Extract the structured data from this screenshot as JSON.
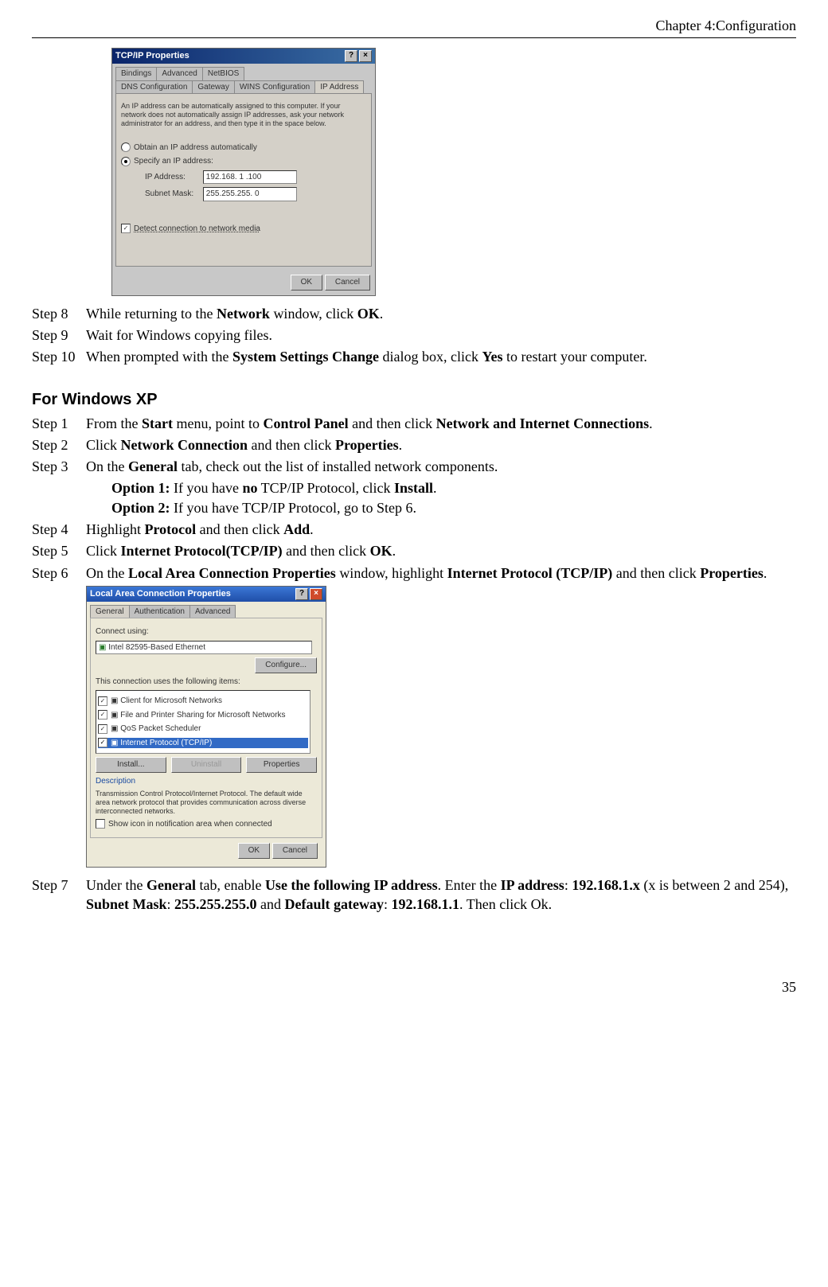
{
  "header": {
    "chapter": "Chapter 4:Configuration"
  },
  "footer": {
    "page": "35"
  },
  "dlg1": {
    "title": "TCP/IP Properties",
    "tabs_row1": [
      "Bindings",
      "Advanced",
      "NetBIOS"
    ],
    "tabs_row2": [
      "DNS Configuration",
      "Gateway",
      "WINS Configuration",
      "IP Address"
    ],
    "desc": "An IP address can be automatically assigned to this computer. If your network does not automatically assign IP addresses, ask your network administrator for an address, and then type it in the space below.",
    "opt_auto": "Obtain an IP address automatically",
    "opt_spec": "Specify an IP address:",
    "lbl_ip": "IP Address:",
    "val_ip": "192.168. 1 .100",
    "lbl_mask": "Subnet Mask:",
    "val_mask": "255.255.255. 0",
    "detect": "Detect connection to network media",
    "ok": "OK",
    "cancel": "Cancel"
  },
  "steps_a": {
    "s8_lbl": "Step 8",
    "s8_a": "While returning to the ",
    "s8_b": "Network",
    "s8_c": " window, click ",
    "s8_d": "OK",
    "s8_e": ".",
    "s9_lbl": "Step 9",
    "s9": "Wait for Windows copying files.",
    "s10_lbl": "Step 10",
    "s10_a": "When prompted with the ",
    "s10_b": "System Settings Change",
    "s10_c": " dialog box, click ",
    "s10_d": "Yes",
    "s10_e": " to restart your computer."
  },
  "section_xp": "For Windows XP",
  "xp": {
    "s1_lbl": "Step 1",
    "s1_a": "From the ",
    "s1_b": "Start",
    "s1_c": " menu, point to ",
    "s1_d": "Control Panel",
    "s1_e": " and then click ",
    "s1_f": "Network and Internet    Connections",
    "s1_g": ".",
    "s2_lbl": "Step 2",
    "s2_a": "Click ",
    "s2_b": "Network Connection",
    "s2_c": " and then click ",
    "s2_d": "Properties",
    "s2_e": ".",
    "s3_lbl": "Step 3",
    "s3_a": "On the ",
    "s3_b": "General",
    "s3_c": " tab, check out the list of installed network components.",
    "s3_o1_a": "Option 1:",
    "s3_o1_b": " If you have ",
    "s3_o1_c": "no",
    "s3_o1_d": " TCP/IP Protocol, click ",
    "s3_o1_e": "Install",
    "s3_o1_f": ".",
    "s3_o2_a": "Option 2:",
    "s3_o2_b": " If you have TCP/IP Protocol, go to Step 6.",
    "s4_lbl": "Step 4",
    "s4_a": "Highlight ",
    "s4_b": "Protocol",
    "s4_c": " and then click ",
    "s4_d": "Add",
    "s4_e": ".",
    "s5_lbl": "Step 5",
    "s5_a": "Click ",
    "s5_b": "Internet Protocol(TCP/IP)",
    "s5_c": " and then click ",
    "s5_d": "OK",
    "s5_e": ".",
    "s6_lbl": "Step 6",
    "s6_a": "On the ",
    "s6_b": "Local Area Connection Properties",
    "s6_c": " window, highlight ",
    "s6_d": "Internet Protocol (TCP/IP)",
    "s6_e": " and then click ",
    "s6_f": "Properties",
    "s6_g": ".",
    "s7_lbl": "Step 7",
    "s7_a": "Under the ",
    "s7_b": "General",
    "s7_c": " tab, enable ",
    "s7_d": "Use the following IP address",
    "s7_e": ". Enter the ",
    "s7_f": "IP address",
    "s7_g": ": ",
    "s7_h": "192.168.1.x",
    "s7_i": " (x is between 2 and 254), ",
    "s7_j": "Subnet Mask",
    "s7_k": ": ",
    "s7_l": "255.255.255.0",
    "s7_m": " and ",
    "s7_n": "Default gateway",
    "s7_o": ": ",
    "s7_p": "192.168.1.1",
    "s7_q": ". Then click Ok."
  },
  "dlg2": {
    "title": "Local Area Connection Properties",
    "tabs": [
      "General",
      "Authentication",
      "Advanced"
    ],
    "connect_using": "Connect using:",
    "nic": "Intel 82595-Based Ethernet",
    "configure": "Configure...",
    "uses": "This connection uses the following items:",
    "items": [
      "Client for Microsoft Networks",
      "File and Printer Sharing for Microsoft Networks",
      "QoS Packet Scheduler",
      "Internet Protocol (TCP/IP)"
    ],
    "install": "Install...",
    "uninstall": "Uninstall",
    "properties": "Properties",
    "desc_lbl": "Description",
    "desc": "Transmission Control Protocol/Internet Protocol. The default wide area network protocol that provides communication across diverse interconnected networks.",
    "show_icon": "Show icon in notification area when connected",
    "ok": "OK",
    "cancel": "Cancel"
  }
}
